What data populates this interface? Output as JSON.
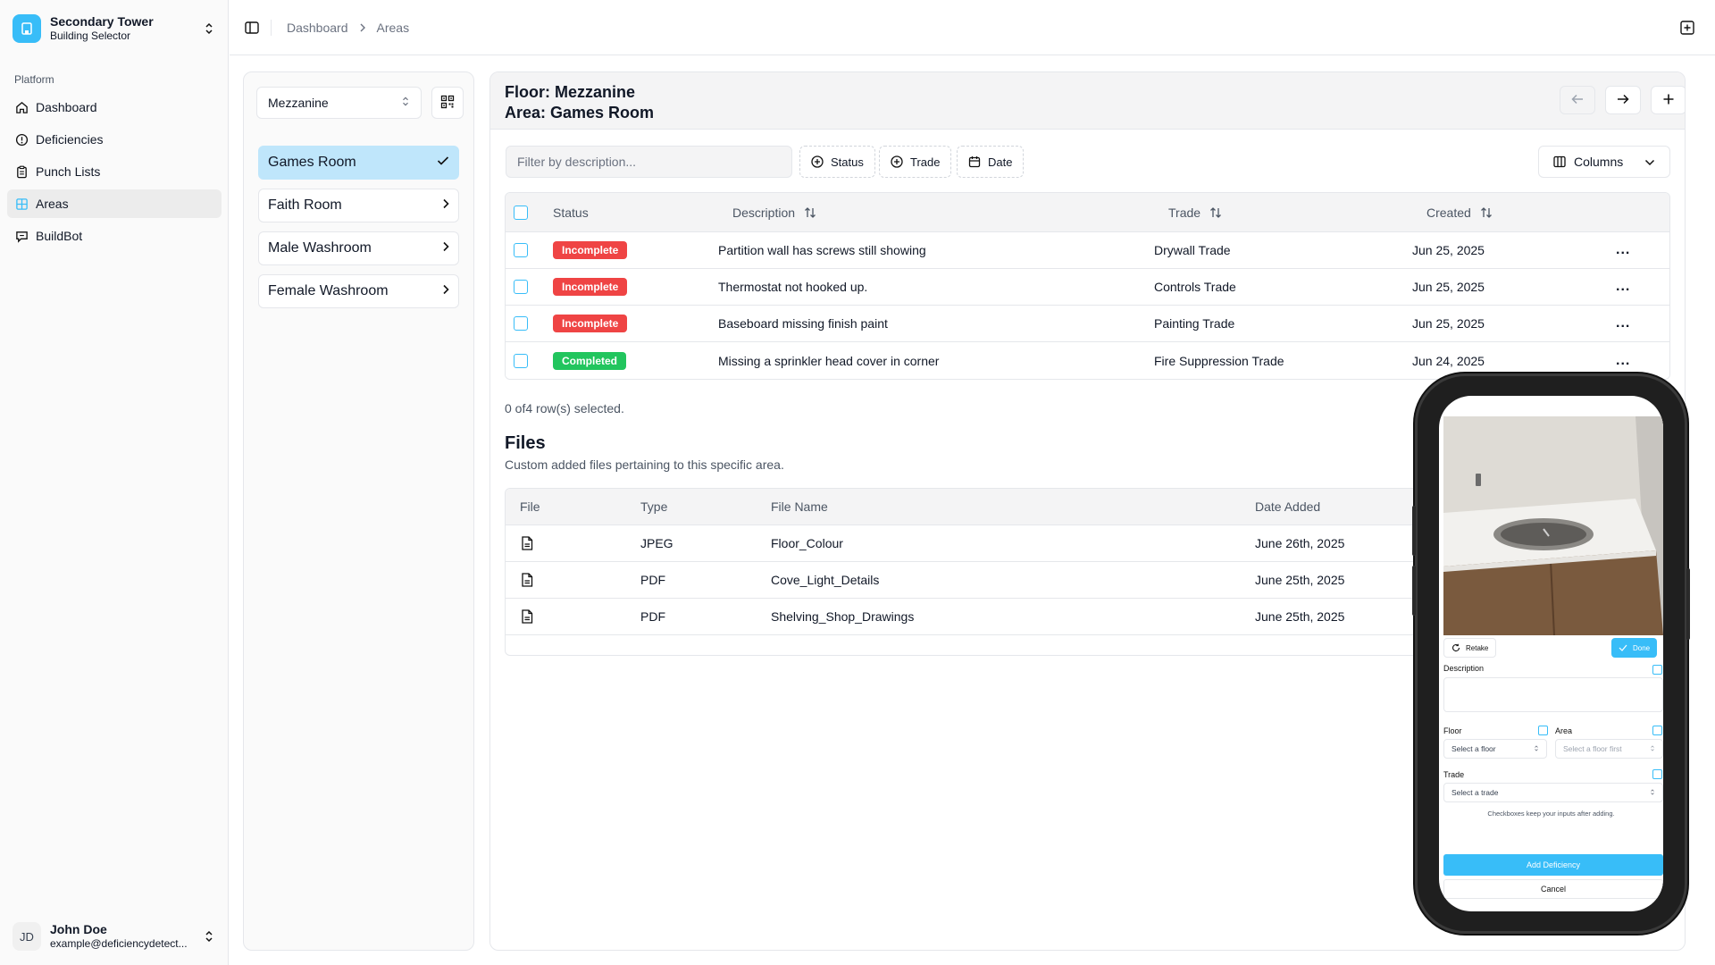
{
  "sidebar": {
    "building_title": "Secondary Tower",
    "building_subtitle": "Building Selector",
    "section_label": "Platform",
    "items": [
      {
        "label": "Dashboard",
        "icon": "home-icon"
      },
      {
        "label": "Deficiencies",
        "icon": "alert-circle-icon"
      },
      {
        "label": "Punch Lists",
        "icon": "clipboard-icon"
      },
      {
        "label": "Areas",
        "icon": "grid-icon",
        "active": true
      },
      {
        "label": "BuildBot",
        "icon": "chat-bot-icon"
      }
    ],
    "user": {
      "initials": "JD",
      "name": "John Doe",
      "email": "example@deficiencydetect..."
    }
  },
  "topbar": {
    "breadcrumbs": [
      "Dashboard",
      "Areas"
    ]
  },
  "floor_panel": {
    "selected_floor": "Mezzanine",
    "areas": [
      {
        "label": "Games Room",
        "selected": true
      },
      {
        "label": "Faith Room"
      },
      {
        "label": "Male Washroom"
      },
      {
        "label": "Female Washroom"
      }
    ]
  },
  "main": {
    "floor_line": "Floor: Mezzanine",
    "area_line": "Area: Games Room",
    "filter_placeholder": "Filter by description...",
    "filters": {
      "status": "Status",
      "trade": "Trade",
      "date": "Date"
    },
    "columns_label": "Columns",
    "table": {
      "headers": {
        "status": "Status",
        "description": "Description",
        "trade": "Trade",
        "created": "Created"
      },
      "rows": [
        {
          "status": "Incomplete",
          "description": "Partition wall has screws still showing",
          "trade": "Drywall Trade",
          "created": "Jun 25, 2025"
        },
        {
          "status": "Incomplete",
          "description": "Thermostat not hooked up.",
          "trade": "Controls Trade",
          "created": "Jun 25, 2025"
        },
        {
          "status": "Incomplete",
          "description": "Baseboard missing finish paint",
          "trade": "Painting Trade",
          "created": "Jun 25, 2025"
        },
        {
          "status": "Completed",
          "description": "Missing a sprinkler head cover in corner",
          "trade": "Fire Suppression Trade",
          "created": "Jun 24, 2025"
        }
      ],
      "more_label": "..."
    },
    "selection_text": "0 of4 row(s) selected.",
    "files": {
      "title": "Files",
      "subtitle": "Custom added files pertaining to this specific area.",
      "headers": {
        "file": "File",
        "type": "Type",
        "name": "File Name",
        "date": "Date Added"
      },
      "rows": [
        {
          "type": "JPEG",
          "name": "Floor_Colour",
          "date": "June 26th, 2025"
        },
        {
          "type": "PDF",
          "name": "Cove_Light_Details",
          "date": "June 25th, 2025"
        },
        {
          "type": "PDF",
          "name": "Shelving_Shop_Drawings",
          "date": "June 25th, 2025"
        }
      ]
    }
  },
  "phone": {
    "retake_label": "Retake",
    "done_label": "Done",
    "description_label": "Description",
    "floor_label": "Floor",
    "area_label": "Area",
    "floor_placeholder": "Select a floor",
    "area_placeholder": "Select a floor first",
    "trade_label": "Trade",
    "trade_placeholder": "Select a trade",
    "hint": "Checkboxes keep your inputs after adding.",
    "add_label": "Add Deficiency",
    "cancel_label": "Cancel"
  },
  "colors": {
    "accent": "#38bdf8",
    "incomplete": "#ef4444",
    "completed": "#22c55e",
    "selected_area": "#bfe6fb"
  }
}
